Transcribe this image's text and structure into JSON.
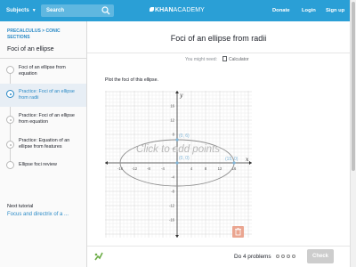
{
  "header": {
    "subjects_label": "Subjects",
    "search_placeholder": "Search",
    "logo_text_bold": "KHAN",
    "logo_text": "ACADEMY",
    "donate_label": "Donate",
    "login_label": "Login",
    "signup_label": "Sign up"
  },
  "sidebar": {
    "breadcrumb": "PRECALCULUS > CONIC SECTIONS",
    "title": "Foci of an ellipse",
    "items": [
      {
        "label": "Foci of an ellipse from equation"
      },
      {
        "label": "Practice: Foci of an ellipse from radii",
        "active": true
      },
      {
        "label": "Practice: Foci of an ellipse from equation"
      },
      {
        "label": "Practice: Equation of an ellipse from features"
      },
      {
        "label": "Ellipse foci review"
      }
    ],
    "next_label": "Next tutorial",
    "next_link": "Focus and directrix of a ..."
  },
  "exercise": {
    "title": "Foci of an ellipse from radii",
    "might_need": "You might need:",
    "calculator": "Calculator",
    "question": "Plot the foci of this ellipse.",
    "graph_overlay": "Click to add points",
    "point_label_center": "(0, 0)",
    "point_label_right": "(15, 0)",
    "point_label_top": "(0, 6)",
    "x_axis_name": "x",
    "y_axis_name": "y",
    "x_ticks": [
      "-16",
      "-12",
      "-8",
      "-4",
      "4",
      "8",
      "12",
      "16"
    ],
    "y_ticks": [
      "16",
      "12",
      "8",
      "4",
      "-4",
      "-8",
      "-12",
      "-16"
    ]
  },
  "footer": {
    "do_problems": "Do 4 problems",
    "check_label": "Check",
    "problem_count": 4
  },
  "colors": {
    "brand": "#2a9fd6",
    "link": "#2a8ac6",
    "ellipse": "#8c8c8c",
    "points": "#7fb5d8",
    "trash": "#eaa590"
  }
}
